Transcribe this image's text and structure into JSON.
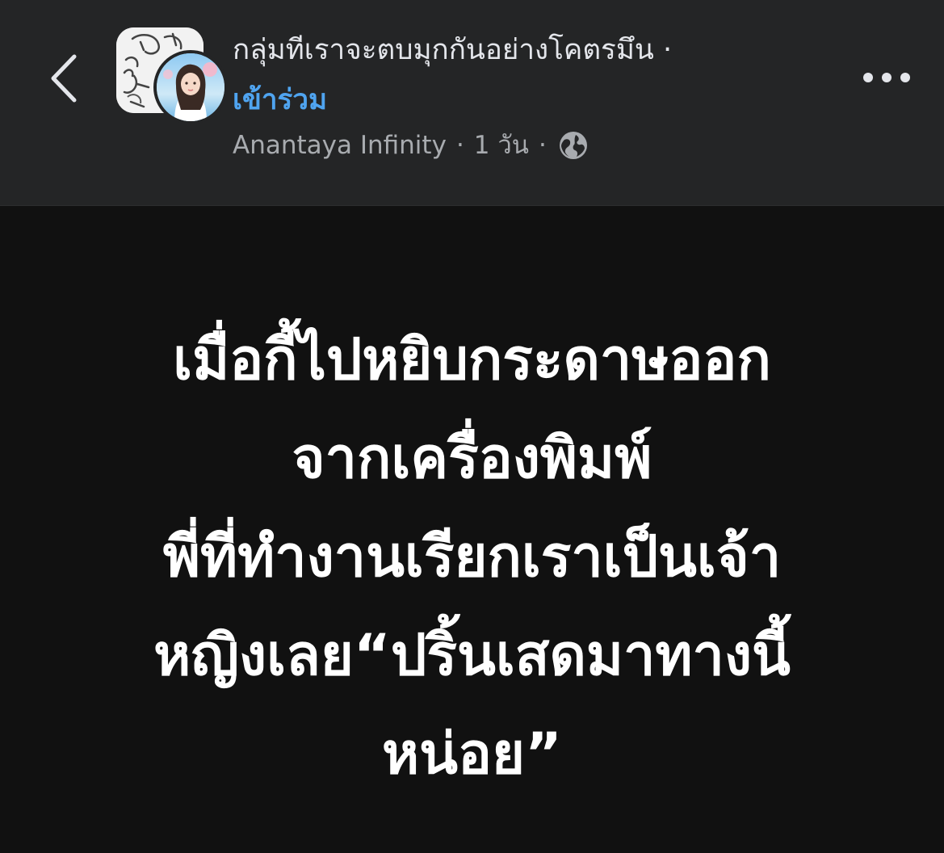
{
  "header": {
    "group_name": "กลุ่มทีเราจะตบมุกกันอย่างโคตรมึน ·",
    "join_label": "เข้าร่วม",
    "author": "Anantaya Infinity",
    "time": "1 วัน",
    "separator": "·",
    "privacy_icon": "globe-icon",
    "back_icon": "chevron-left-icon",
    "more_icon": "more-dots-icon"
  },
  "post": {
    "lines": [
      "เมื่อกี้ไปหยิบกระดาษออก",
      "จากเครื่องพิมพ์",
      "พี่ที่ทำงานเรียกเราเป็นเจ้า",
      "หญิงเลย“ปริ้นเสดมาทางนี้",
      "หน่อย”"
    ]
  },
  "colors": {
    "header_bg": "#242526",
    "body_bg": "#111111",
    "link": "#4fa4f0",
    "text_primary": "#e4e6eb",
    "text_secondary": "#a8abaf"
  }
}
